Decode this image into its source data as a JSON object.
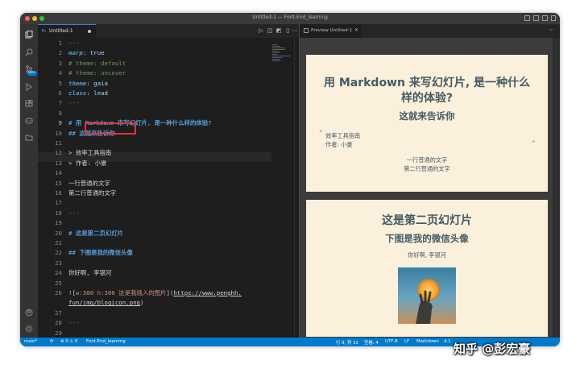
{
  "window": {
    "title": "Untitled-1 — Font-End_learning",
    "traffic_lights": {
      "close": "#ff5f57",
      "minimize": "#febc2e",
      "zoom": "#28c840"
    }
  },
  "activity_bar": {
    "icons": [
      "explorer-icon",
      "search-icon",
      "source-control-icon",
      "run-debug-icon",
      "extensions-icon",
      "remote-explorer-icon",
      "folder-icon"
    ],
    "scm_badge": "90+",
    "bottom_icons": [
      "account-icon",
      "settings-gear-icon"
    ]
  },
  "editor": {
    "tab_label": "Untitled-1",
    "tab_icon": "M↓",
    "lines": [
      {
        "n": "1",
        "parts": [
          [
            "---",
            "k-gray"
          ]
        ]
      },
      {
        "n": "2",
        "parts": [
          [
            "marp",
            "k-bi"
          ],
          [
            ": ",
            ""
          ],
          [
            "true",
            "k-str"
          ]
        ]
      },
      {
        "n": "3",
        "parts": [
          [
            "# theme: default",
            "k-cm"
          ]
        ]
      },
      {
        "n": "4",
        "parts": [
          [
            "# theme: uncover",
            "k-cm"
          ]
        ]
      },
      {
        "n": "5",
        "parts": [
          [
            "theme",
            "k-bi"
          ],
          [
            ": ",
            ""
          ],
          [
            "gaia",
            "k-str"
          ]
        ]
      },
      {
        "n": "6",
        "parts": [
          [
            "class",
            "k-bi"
          ],
          [
            ": ",
            ""
          ],
          [
            "lead",
            "k-str"
          ]
        ]
      },
      {
        "n": "7",
        "parts": [
          [
            "---",
            "k-gray"
          ]
        ]
      },
      {
        "n": "8",
        "parts": []
      },
      {
        "n": "9",
        "parts": [
          [
            "# 用 Markdown 来写幻灯片, 是一种什么样的体验?",
            "k-h"
          ]
        ]
      },
      {
        "n": "10",
        "parts": [
          [
            "## 这就来告诉你",
            "k-h"
          ]
        ]
      },
      {
        "n": "11",
        "parts": []
      },
      {
        "n": "12",
        "parts": [
          [
            "> 效率工具指南",
            ""
          ]
        ]
      },
      {
        "n": "13",
        "parts": [
          [
            "> 作者: 小豪",
            ""
          ]
        ]
      },
      {
        "n": "14",
        "parts": []
      },
      {
        "n": "15",
        "parts": [
          [
            "一行普通的文字",
            ""
          ]
        ]
      },
      {
        "n": "16",
        "parts": [
          [
            "第二行普通的文字",
            ""
          ]
        ]
      },
      {
        "n": "17",
        "parts": []
      },
      {
        "n": "18",
        "parts": [
          [
            "---",
            "k-gray"
          ]
        ]
      },
      {
        "n": "19",
        "parts": []
      },
      {
        "n": "20",
        "parts": [
          [
            "# 这是第二页幻灯片",
            "k-h"
          ]
        ]
      },
      {
        "n": "21",
        "parts": []
      },
      {
        "n": "22",
        "parts": [
          [
            "## 下图是我的微信头像",
            "k-h"
          ]
        ]
      },
      {
        "n": "23",
        "parts": []
      },
      {
        "n": "24",
        "parts": [
          [
            "你好啊, 李银河",
            ""
          ]
        ]
      },
      {
        "n": "25",
        "parts": []
      },
      {
        "n": "26",
        "parts": [
          [
            "![",
            ""
          ],
          [
            "w:300 h:300 这是我插入的图片",
            "k-alt"
          ],
          [
            "](",
            ""
          ],
          [
            "https://www.penghh.",
            "k-link"
          ]
        ]
      },
      {
        "n": "",
        "parts": [
          [
            "fun/img/blogicon.png",
            "k-link"
          ],
          [
            ")",
            ""
          ]
        ]
      },
      {
        "n": "27",
        "parts": []
      },
      {
        "n": "28",
        "parts": [
          [
            "---",
            "k-gray"
          ]
        ]
      },
      {
        "n": "29",
        "parts": []
      }
    ],
    "active_line": "9"
  },
  "preview": {
    "tab_label": "Preview Untitled-1",
    "slide1": {
      "h1_line1": "用 Markdown 来写幻灯片, 是一种什么",
      "h1_line2": "样的体验?",
      "h2": "这就来告诉你",
      "quote_line1": "效率工具指南",
      "quote_line2": "作者: 小豪",
      "para1": "一行普通的文字",
      "para2": "第二行普通的文字"
    },
    "slide2": {
      "h1": "这是第二页幻灯片",
      "h2": "下图是我的微信头像",
      "para": "你好啊, 李银河"
    }
  },
  "statusbar": {
    "branch": "main*",
    "sync": "⟳",
    "problems": "⊗ 0 ⚠ 0",
    "folder": "Font-End_learning",
    "position": "行 9, 列 32",
    "spaces": "空格: 4",
    "encoding": "UTF-8",
    "eol": "LF",
    "language": "Markdown",
    "extra": "4.1",
    "color": "#007acc"
  },
  "watermark": "知乎 @彭宏豪"
}
